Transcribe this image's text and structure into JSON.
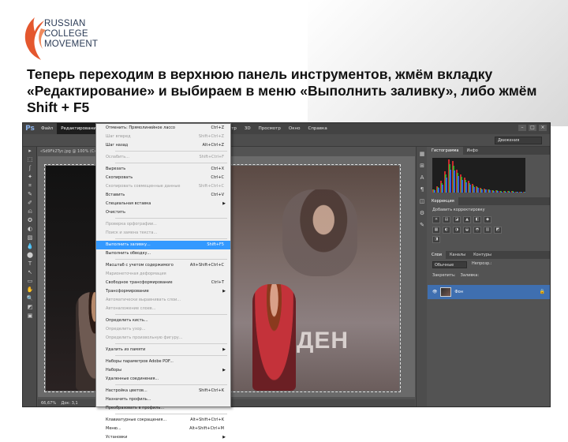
{
  "brand": {
    "lines": [
      "RUSSIAN",
      "COLLEGE",
      "MOVEMENT"
    ],
    "accent_color": "#e4572e"
  },
  "heading": "Теперь переходим в верхнюю панель инструментов, жмём вкладку «Редактирование» и выбираем в меню «Выполнить заливку», либо жмём Shift + F5",
  "ps": {
    "logo": "Ps",
    "menus": [
      {
        "label": "Файл",
        "active": false
      },
      {
        "label": "Редактирование",
        "active": true
      },
      {
        "label": "Изображение",
        "active": false
      },
      {
        "label": "Слои",
        "active": false
      },
      {
        "label": "Текст",
        "active": false
      },
      {
        "label": "Выделение",
        "active": false
      },
      {
        "label": "Фильтр",
        "active": false
      },
      {
        "label": "3D",
        "active": false
      },
      {
        "label": "Просмотр",
        "active": false
      },
      {
        "label": "Окно",
        "active": false
      },
      {
        "label": "Справка",
        "active": false
      }
    ],
    "window_controls": [
      "–",
      "□",
      "×"
    ],
    "preset": "Движения",
    "doc_tab": "«Sd9Fk2Tyc.jpg @ 100% (С»",
    "status_zoom": "66,67%",
    "status_doc": "Док: 3,1",
    "tools": [
      "▸",
      "⬚",
      "ʃ",
      "✦",
      "⌗",
      "✎",
      "✐",
      "⎌",
      "✪",
      "◐",
      "▧",
      "💧",
      "⬤",
      "T",
      "↖",
      "▭",
      "✋",
      "🔍",
      "◩",
      "▣"
    ],
    "panel_icons": [
      "▦",
      "⊞",
      "A",
      "¶",
      "◫",
      "⚙",
      "✎"
    ],
    "right": {
      "histogram_tabs": [
        {
          "label": "Гистограмма",
          "active": true
        },
        {
          "label": "Инфо",
          "active": false
        }
      ],
      "correction_tabs": [
        {
          "label": "Коррекция",
          "active": true
        }
      ],
      "correction_title": "Добавить корректировку",
      "correction_icons_row1": [
        "☀",
        "▤",
        "◪",
        "▲",
        "◧",
        "◆"
      ],
      "correction_icons_row2": [
        "▦",
        "◐",
        "◑",
        "◒",
        "◓",
        "▥",
        "◩",
        "◨"
      ],
      "layers_tabs": [
        {
          "label": "Слои",
          "active": true
        },
        {
          "label": "Каналы",
          "active": false
        },
        {
          "label": "Контуры",
          "active": false
        }
      ],
      "blend_mode": "Обычные",
      "opacity_label": "Непрозр.:",
      "lock_label": "Закрепить:",
      "fill_label": "Заливка:",
      "layer_name": "Фон",
      "histogram": [
        4,
        8,
        14,
        26,
        40,
        38,
        28,
        22,
        18,
        14,
        10,
        8,
        6,
        5,
        4,
        3,
        3,
        2,
        2,
        2,
        2,
        1,
        1,
        1
      ],
      "histogram_colors": [
        "#e83030",
        "#30c030",
        "#4060ff"
      ]
    }
  },
  "dropdown": {
    "items": [
      {
        "type": "item",
        "label": "Отменить: Прямолинейное лассо",
        "shortcut": "Ctrl+Z",
        "disabled": false,
        "highlight": false,
        "submenu": false
      },
      {
        "type": "item",
        "label": "Шаг вперед",
        "shortcut": "Shift+Ctrl+Z",
        "disabled": true,
        "highlight": false,
        "submenu": false
      },
      {
        "type": "item",
        "label": "Шаг назад",
        "shortcut": "Alt+Ctrl+Z",
        "disabled": false,
        "highlight": false,
        "submenu": false
      },
      {
        "type": "sep"
      },
      {
        "type": "item",
        "label": "Ослабить...",
        "shortcut": "Shift+Ctrl+F",
        "disabled": true,
        "highlight": false,
        "submenu": false
      },
      {
        "type": "sep"
      },
      {
        "type": "item",
        "label": "Вырезать",
        "shortcut": "Ctrl+X",
        "disabled": false,
        "highlight": false,
        "submenu": false
      },
      {
        "type": "item",
        "label": "Скопировать",
        "shortcut": "Ctrl+C",
        "disabled": false,
        "highlight": false,
        "submenu": false
      },
      {
        "type": "item",
        "label": "Скопировать совмещенные данные",
        "shortcut": "Shift+Ctrl+C",
        "disabled": true,
        "highlight": false,
        "submenu": false
      },
      {
        "type": "item",
        "label": "Вставить",
        "shortcut": "Ctrl+V",
        "disabled": false,
        "highlight": false,
        "submenu": false
      },
      {
        "type": "item",
        "label": "Специальная вставка",
        "shortcut": "",
        "disabled": false,
        "highlight": false,
        "submenu": true
      },
      {
        "type": "item",
        "label": "Очистить",
        "shortcut": "",
        "disabled": false,
        "highlight": false,
        "submenu": false
      },
      {
        "type": "sep"
      },
      {
        "type": "item",
        "label": "Проверка орфографии...",
        "shortcut": "",
        "disabled": true,
        "highlight": false,
        "submenu": false
      },
      {
        "type": "item",
        "label": "Поиск и замена текста...",
        "shortcut": "",
        "disabled": true,
        "highlight": false,
        "submenu": false
      },
      {
        "type": "sep"
      },
      {
        "type": "item",
        "label": "Выполнить заливку...",
        "shortcut": "Shift+F5",
        "disabled": false,
        "highlight": true,
        "submenu": false
      },
      {
        "type": "item",
        "label": "Выполнить обводку...",
        "shortcut": "",
        "disabled": false,
        "highlight": false,
        "submenu": false
      },
      {
        "type": "sep"
      },
      {
        "type": "item",
        "label": "Масштаб с учетом содержимого",
        "shortcut": "Alt+Shift+Ctrl+C",
        "disabled": false,
        "highlight": false,
        "submenu": false
      },
      {
        "type": "item",
        "label": "Марионеточная деформация",
        "shortcut": "",
        "disabled": true,
        "highlight": false,
        "submenu": false
      },
      {
        "type": "item",
        "label": "Свободное трансформирование",
        "shortcut": "Ctrl+T",
        "disabled": false,
        "highlight": false,
        "submenu": false
      },
      {
        "type": "item",
        "label": "Трансформирование",
        "shortcut": "",
        "disabled": false,
        "highlight": false,
        "submenu": true
      },
      {
        "type": "item",
        "label": "Автоматически выравнивать слои...",
        "shortcut": "",
        "disabled": true,
        "highlight": false,
        "submenu": false
      },
      {
        "type": "item",
        "label": "Автоналожение слоев...",
        "shortcut": "",
        "disabled": true,
        "highlight": false,
        "submenu": false
      },
      {
        "type": "sep"
      },
      {
        "type": "item",
        "label": "Определить кисть...",
        "shortcut": "",
        "disabled": false,
        "highlight": false,
        "submenu": false
      },
      {
        "type": "item",
        "label": "Определить узор...",
        "shortcut": "",
        "disabled": true,
        "highlight": false,
        "submenu": false
      },
      {
        "type": "item",
        "label": "Определить произвольную фигуру...",
        "shortcut": "",
        "disabled": true,
        "highlight": false,
        "submenu": false
      },
      {
        "type": "sep"
      },
      {
        "type": "item",
        "label": "Удалить из памяти",
        "shortcut": "",
        "disabled": false,
        "highlight": false,
        "submenu": true
      },
      {
        "type": "sep"
      },
      {
        "type": "item",
        "label": "Наборы параметров Adobe PDF...",
        "shortcut": "",
        "disabled": false,
        "highlight": false,
        "submenu": false
      },
      {
        "type": "item",
        "label": "Наборы",
        "shortcut": "",
        "disabled": false,
        "highlight": false,
        "submenu": true
      },
      {
        "type": "item",
        "label": "Удаленные соединения...",
        "shortcut": "",
        "disabled": false,
        "highlight": false,
        "submenu": false
      },
      {
        "type": "sep"
      },
      {
        "type": "item",
        "label": "Настройка цветов...",
        "shortcut": "Shift+Ctrl+K",
        "disabled": false,
        "highlight": false,
        "submenu": false
      },
      {
        "type": "item",
        "label": "Назначить профиль...",
        "shortcut": "",
        "disabled": false,
        "highlight": false,
        "submenu": false
      },
      {
        "type": "item",
        "label": "Преобразовать в профиль...",
        "shortcut": "",
        "disabled": false,
        "highlight": false,
        "submenu": false
      },
      {
        "type": "sep"
      },
      {
        "type": "item",
        "label": "Клавиатурные сокращения...",
        "shortcut": "Alt+Shift+Ctrl+K",
        "disabled": false,
        "highlight": false,
        "submenu": false
      },
      {
        "type": "item",
        "label": "Меню...",
        "shortcut": "Alt+Shift+Ctrl+M",
        "disabled": false,
        "highlight": false,
        "submenu": false
      },
      {
        "type": "item",
        "label": "Установки",
        "shortcut": "",
        "disabled": false,
        "highlight": false,
        "submenu": true
      }
    ]
  },
  "photo": {
    "banner_text": "ДЕН"
  }
}
